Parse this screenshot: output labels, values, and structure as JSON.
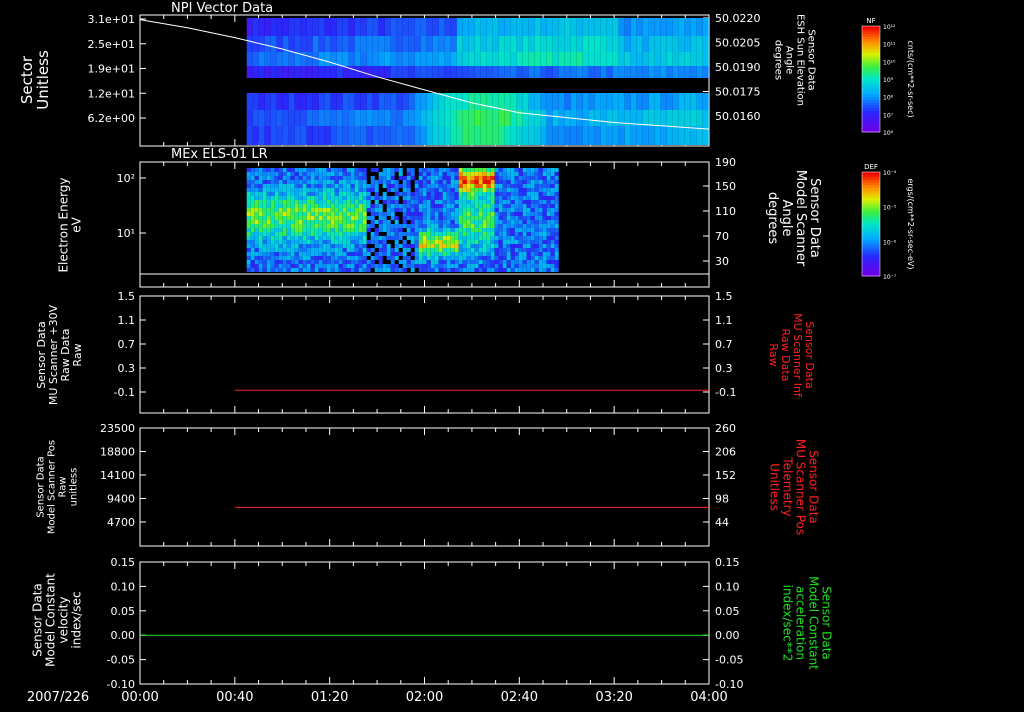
{
  "date_label": "2007/226",
  "x_axis": {
    "type": "time",
    "range": [
      "00:00",
      "04:00"
    ],
    "tick_labels": [
      "00:00",
      "00:40",
      "01:20",
      "02:00",
      "02:40",
      "03:20",
      "04:00"
    ]
  },
  "chart_data": [
    {
      "type": "heatmap",
      "title": "NPI Vector Data",
      "ylabel": [
        "Sector",
        "Unitless"
      ],
      "ytick_labels": [
        "3.1e+01",
        "2.5e+01",
        "1.9e+01",
        "1.2e+01",
        "6.2e+00"
      ],
      "ylabel_right": [
        "Sensor Data",
        "ESH Sun Elevation",
        "Angle",
        "degrees"
      ],
      "ytick_labels_right": [
        "50.0220",
        "50.0205",
        "50.0190",
        "50.0175",
        "50.0160"
      ],
      "colorbar": {
        "label": "NF",
        "units": "cnts/(cm**2-sr-sec)",
        "tick_labels": [
          "10¹²",
          "10¹¹",
          "10¹⁰",
          "10⁹",
          "10⁸",
          "10⁷",
          "10⁶"
        ]
      },
      "data_start": "00:45",
      "data_end": "04:00",
      "line_series": {
        "axis": "right",
        "color": "#ffffff",
        "x": [
          "00:00",
          "00:20",
          "00:40",
          "01:00",
          "01:20",
          "01:40",
          "02:00",
          "02:20",
          "02:40",
          "03:00",
          "03:20",
          "03:40",
          "04:00"
        ],
        "y": [
          50.0219,
          50.0214,
          50.0208,
          50.0201,
          50.0193,
          50.0184,
          50.0176,
          50.0168,
          50.0162,
          50.0159,
          50.0156,
          50.0154,
          50.0152
        ]
      }
    },
    {
      "type": "heatmap",
      "title": "MEx ELS-01 LR",
      "ylabel": [
        "Electron Energy",
        "eV"
      ],
      "ytick_labels": [
        "10²",
        "10¹"
      ],
      "ylabel_right": [
        "Sensor Data",
        "Model Scanner",
        "Angle",
        "degrees"
      ],
      "ytick_labels_right": [
        "190",
        "150",
        "110",
        "70",
        "30"
      ],
      "colorbar": {
        "label": "DEF",
        "units": "ergs/(cm**2-sr-sec-eV)",
        "tick_labels": [
          "10⁻⁴",
          "10⁻⁵",
          "10⁻⁶",
          "10⁻⁷"
        ]
      },
      "data_start": "00:45",
      "data_end": "02:55",
      "line_series": {
        "axis": "right",
        "color": "#ffffff",
        "value": 10
      }
    },
    {
      "type": "line",
      "ylabel": [
        "Sensor Data",
        "MU Scanner +30V",
        "Raw Data",
        "Raw"
      ],
      "ytick_labels": [
        "1.5",
        "1.1",
        "0.7",
        "0.3",
        "-0.1"
      ],
      "ylim": [
        -0.35,
        1.5
      ],
      "ylabel_right": [
        "Sensor Data",
        "MU Scanner Inf",
        "Raw Data",
        "Raw"
      ],
      "ytick_labels_right": [
        "1.5",
        "1.1",
        "0.7",
        "0.3",
        "-0.1"
      ],
      "right_label_color": "#ff2020",
      "series": [
        {
          "color": "#ff2020",
          "x_start": "00:40",
          "x_end": "04:00",
          "value": 0.01
        }
      ]
    },
    {
      "type": "line",
      "ylabel": [
        "Sensor Data",
        "Model Scanner Pos",
        "Raw",
        "unitless"
      ],
      "ytick_labels": [
        "23500",
        "18800",
        "14100",
        "9400",
        "4700"
      ],
      "ylim": [
        0,
        23500
      ],
      "ylabel_right": [
        "Sensor Data",
        "MU Scanner Pos",
        "Telemetry",
        "Unitless"
      ],
      "ytick_labels_right": [
        "260",
        "206",
        "152",
        "98",
        "44"
      ],
      "right_label_color": "#ff2020",
      "series": [
        {
          "color": "#ff2020",
          "x_start": "00:40",
          "x_end": "04:00",
          "value": 7700
        }
      ]
    },
    {
      "type": "line",
      "ylabel": [
        "Sensor Data",
        "Model Constant",
        "velocity",
        "index/sec"
      ],
      "ytick_labels": [
        "0.15",
        "0.10",
        "0.05",
        "0.00",
        "-0.05",
        "-0.10"
      ],
      "ylim": [
        -0.1,
        0.15
      ],
      "ylabel_right": [
        "Sensor Data",
        "Model Constant",
        "acceleration",
        "index/sec**2"
      ],
      "ytick_labels_right": [
        "0.15",
        "0.10",
        "0.05",
        "0.00",
        "-0.05",
        "-0.10"
      ],
      "right_label_color": "#20e020",
      "series": [
        {
          "color": "#20e020",
          "x_start": "00:00",
          "x_end": "04:00",
          "value": 0.0
        }
      ]
    }
  ]
}
